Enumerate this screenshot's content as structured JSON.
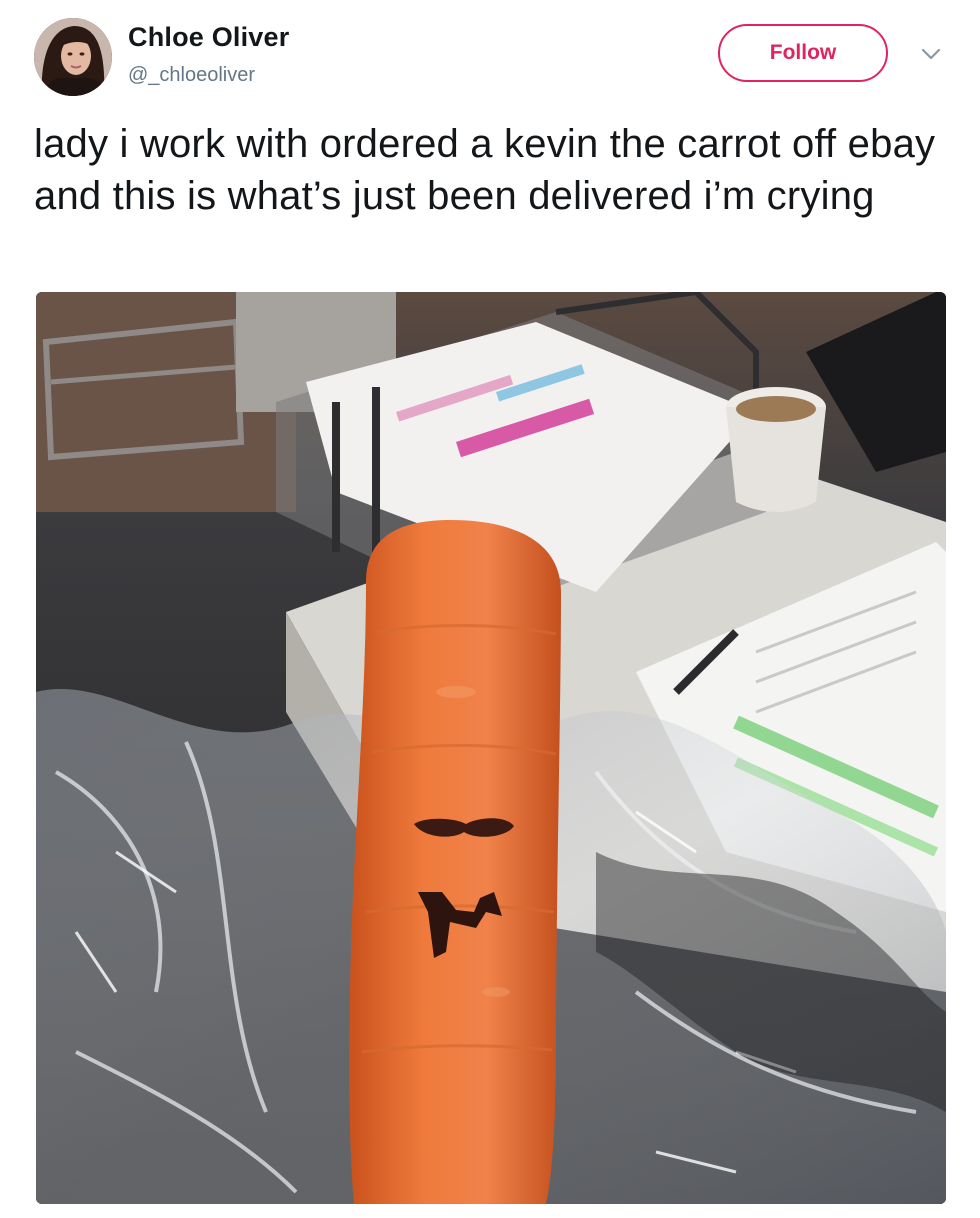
{
  "tweet": {
    "author": {
      "display_name": "Chloe Oliver",
      "handle": "@_chloeoliver"
    },
    "follow_label": "Follow",
    "text": "lady i work with ordered a kevin the carrot off ebay and this is what’s just been delivered i’m crying",
    "colors": {
      "accent": "#e0245e",
      "text": "#14171a",
      "secondary": "#657786"
    }
  }
}
